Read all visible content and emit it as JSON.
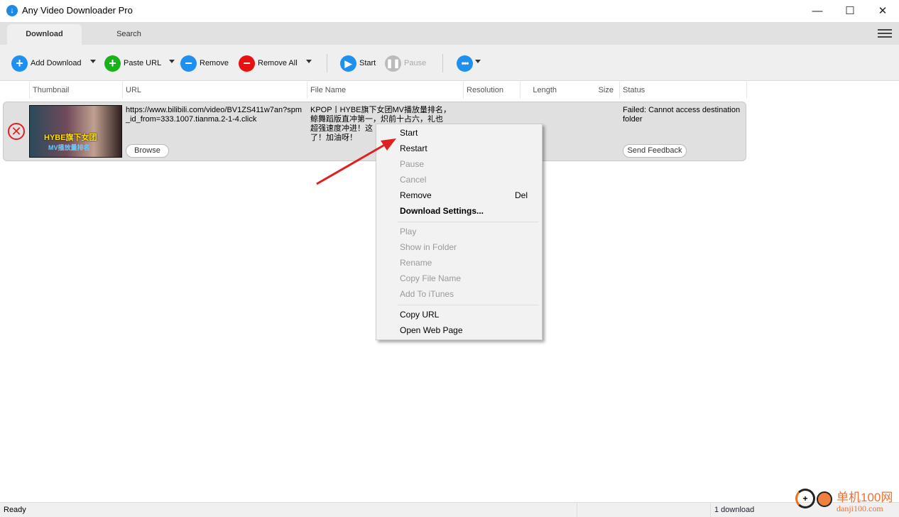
{
  "window": {
    "title": "Any Video Downloader Pro",
    "minimize": "—",
    "maximize": "☐",
    "close": "✕"
  },
  "tabs": [
    {
      "label": "Download",
      "active": true
    },
    {
      "label": "Search",
      "active": false
    }
  ],
  "toolbar": {
    "add_download": "Add Download",
    "paste_url": "Paste URL",
    "remove": "Remove",
    "remove_all": "Remove All",
    "start": "Start",
    "pause": "Pause"
  },
  "columns": {
    "thumbnail": "Thumbnail",
    "url": "URL",
    "file_name": "File Name",
    "resolution": "Resolution",
    "length": "Length",
    "size": "Size",
    "status": "Status"
  },
  "download": {
    "url_line1": "https://www.bilibili.com/video/BV1ZS411w7an?spm",
    "url_line2": "_id_from=333.1007.tianma.2-1-4.click",
    "file_line1": "KPOP丨HYBE旗下女团MV播放量排名，",
    "file_line2": "鲸舞蹈版直冲第一，炽前十占六，礼也",
    "file_line3": "超强速度冲进！这",
    "file_line4": "了！加油呀！",
    "thumb_text1": "HYBE旗下女团",
    "thumb_text2": "MV播放量排名",
    "browse": "Browse",
    "status": "Failed: Cannot access destination folder",
    "feedback": "Send Feedback"
  },
  "context_menu": [
    {
      "label": "Start",
      "enabled": true
    },
    {
      "label": "Restart",
      "enabled": true
    },
    {
      "label": "Pause",
      "enabled": false
    },
    {
      "label": "Cancel",
      "enabled": false
    },
    {
      "label": "Remove",
      "enabled": true,
      "shortcut": "Del"
    },
    {
      "label": "Download Settings...",
      "enabled": true,
      "bold": true
    },
    {
      "label": "Play",
      "enabled": false
    },
    {
      "label": "Show in Folder",
      "enabled": false
    },
    {
      "label": "Rename",
      "enabled": false
    },
    {
      "label": "Copy File Name",
      "enabled": false
    },
    {
      "label": "Add To iTunes",
      "enabled": false
    },
    {
      "label": "Copy URL",
      "enabled": true
    },
    {
      "label": "Open Web Page",
      "enabled": true
    }
  ],
  "statusbar": {
    "left": "Ready",
    "count": "1 download"
  },
  "watermark": {
    "text1": "单机100网",
    "text2": "danji100.com"
  },
  "colors": {
    "blue": "#1e90f0",
    "green": "#1ab21a",
    "red": "#e81010",
    "annotation_arrow": "#e02020"
  }
}
